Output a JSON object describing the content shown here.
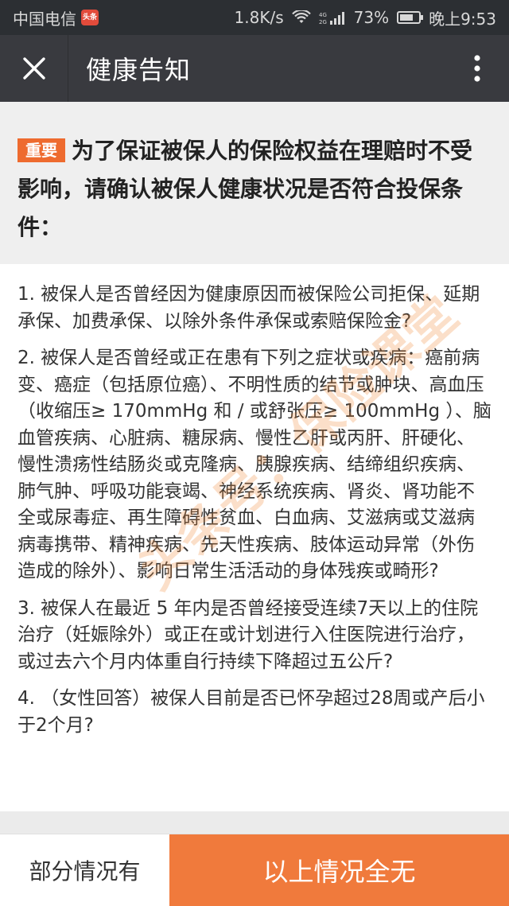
{
  "status_bar": {
    "carrier": "中国电信",
    "carrier_badge": "头条",
    "net_speed": "1.8K/s",
    "network_type": "4G",
    "battery": "73%",
    "time": "晚上9:53"
  },
  "header": {
    "title": "健康告知",
    "close_icon": "close-icon",
    "more_icon": "more-vertical-icon"
  },
  "notice": {
    "badge": "重要",
    "text": "为了保证被保人的保险权益在理赔时不受影响，请确认被保人健康状况是否符合投保条件："
  },
  "questions": [
    "1. 被保人是否曾经因为健康原因而被保险公司拒保、延期承保、加费承保、以除外条件承保或索赔保险金?",
    "2. 被保人是否曾经或正在患有下列之症状或疾病：癌前病变、癌症（包括原位癌）、不明性质的结节或肿块、高血压（收缩压≥ 170mmHg 和 / 或舒张压≥ 100mmHg ）、脑血管疾病、心脏病、糖尿病、慢性乙肝或丙肝、肝硬化、慢性溃疡性结肠炎或克隆病、胰腺疾病、结缔组织疾病、肺气肿、呼吸功能衰竭、神经系统疾病、肾炎、肾功能不全或尿毒症、再生障碍性贫血、白血病、艾滋病或艾滋病病毒携带、精神疾病、先天性疾病、肢体运动异常（外伤造成的除外）、影响日常生活活动的身体残疾或畸形?",
    "3. 被保人在最近 5 年内是否曾经接受连续7天以上的住院治疗（妊娠除外）或正在或计划进行入住医院进行治疗，或过去六个月内体重自行持续下降超过五公斤?",
    "4. （女性回答）被保人目前是否已怀孕超过28周或产后小于2个月?"
  ],
  "watermark": "头条号：保险课堂",
  "footer": {
    "partial_label": "部分情况有",
    "none_label": "以上情况全无"
  },
  "colors": {
    "accent": "#f07a3c",
    "badge": "#ee6b2f",
    "title_bar": "#393a3f",
    "status_bar": "#2c2f33"
  }
}
